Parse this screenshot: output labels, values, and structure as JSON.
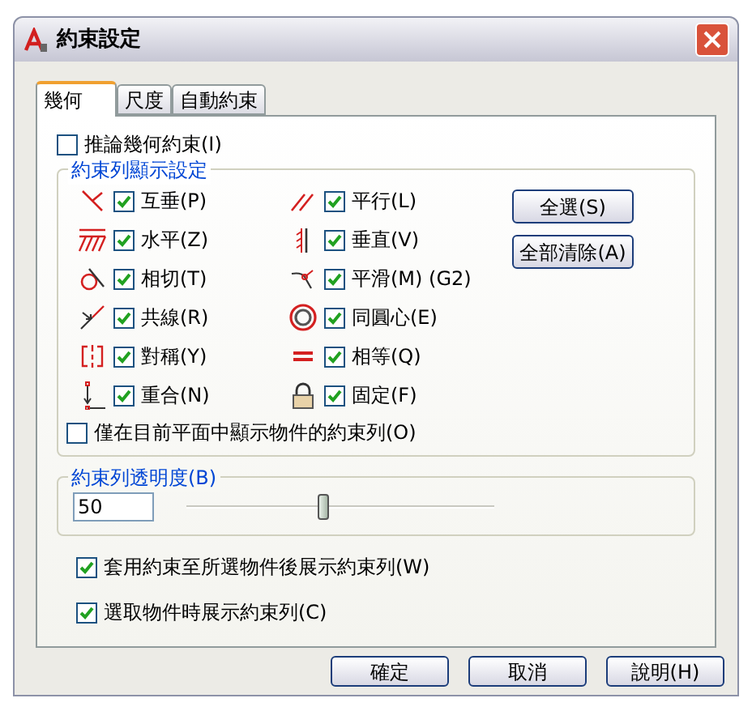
{
  "window": {
    "title": "約束設定"
  },
  "tabs": [
    {
      "label": "幾何",
      "selected": true
    },
    {
      "label": "尺度",
      "selected": false
    },
    {
      "label": "自動約束",
      "selected": false
    }
  ],
  "infer": {
    "label": "推論幾何約束(I)",
    "checked": false
  },
  "bar_display": {
    "title": "約束列顯示設定",
    "constraints": [
      {
        "kind": "perpendicular",
        "label": "互垂(P)",
        "checked": true
      },
      {
        "kind": "parallel",
        "label": "平行(L)",
        "checked": true
      },
      {
        "kind": "horizontal",
        "label": "水平(Z)",
        "checked": true
      },
      {
        "kind": "vertical",
        "label": "垂直(V)",
        "checked": true
      },
      {
        "kind": "tangent",
        "label": "相切(T)",
        "checked": true
      },
      {
        "kind": "smooth",
        "label": "平滑(M) (G2)",
        "checked": true
      },
      {
        "kind": "collinear",
        "label": "共線(R)",
        "checked": true
      },
      {
        "kind": "concentric",
        "label": "同圓心(E)",
        "checked": true
      },
      {
        "kind": "symmetric",
        "label": "對稱(Y)",
        "checked": true
      },
      {
        "kind": "equal",
        "label": "相等(Q)",
        "checked": true
      },
      {
        "kind": "coincident",
        "label": "重合(N)",
        "checked": true
      },
      {
        "kind": "fix",
        "label": "固定(F)",
        "checked": true
      }
    ],
    "buttons": [
      "全選(S)",
      "全部清除(A)"
    ],
    "current_plane": {
      "label": "僅在目前平面中顯示物件的約束列(O)",
      "checked": false
    }
  },
  "transparency": {
    "title": "約束列透明度(B)",
    "value": "50",
    "level": 0.44
  },
  "options": [
    {
      "label": "套用約束至所選物件後展示約束列(W)",
      "checked": true
    },
    {
      "label": "選取物件時展示約束列(C)",
      "checked": true
    }
  ],
  "buttons": [
    "確定",
    "取消",
    "說明(H)"
  ]
}
